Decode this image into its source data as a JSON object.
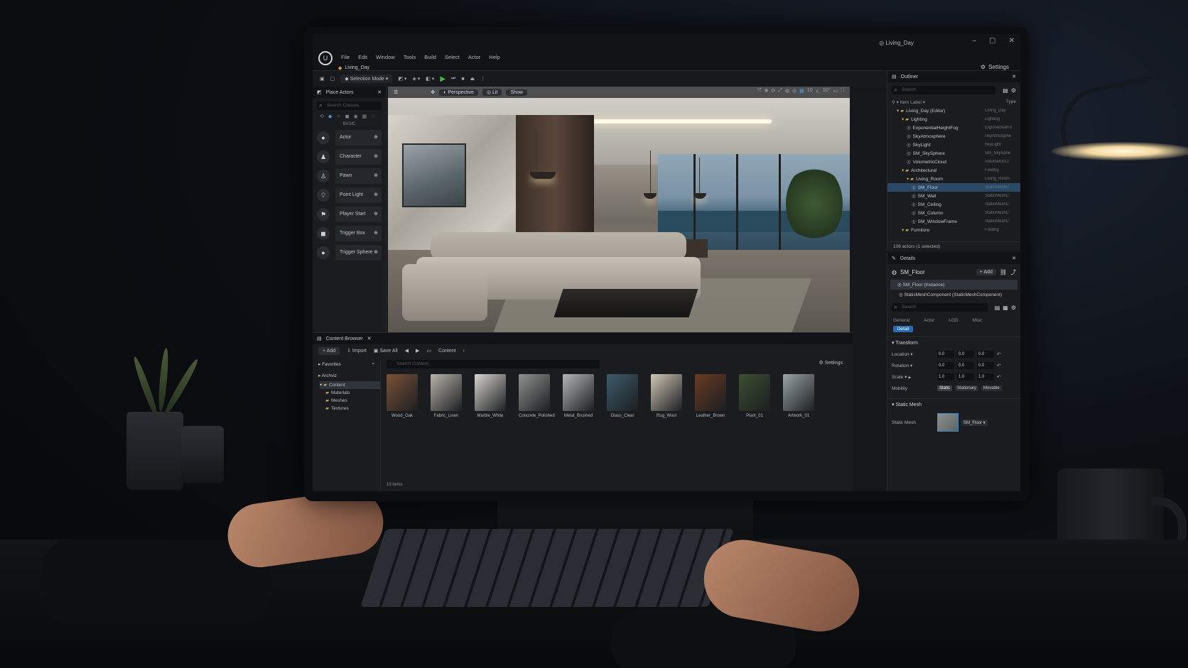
{
  "window": {
    "title": "Living_Day",
    "doc_tab": "Living_Day",
    "settings": "Settings"
  },
  "menu": [
    "File",
    "Edit",
    "Window",
    "Tools",
    "Build",
    "Select",
    "Actor",
    "Help"
  ],
  "toolbar": {
    "mode": "Selection Mode"
  },
  "viewport": {
    "perspective": "Perspective",
    "lit": "Lit",
    "show": "Show",
    "snap_value": "10",
    "snap_angle": "10°"
  },
  "place_actors": {
    "tab": "Place Actors",
    "search_placeholder": "Search Classes",
    "category": "BASIC",
    "items": [
      {
        "label": "Actor",
        "icon": "sphere-icon"
      },
      {
        "label": "Character",
        "icon": "character-icon"
      },
      {
        "label": "Pawn",
        "icon": "pawn-icon"
      },
      {
        "label": "Point Light",
        "icon": "bulb-icon"
      },
      {
        "label": "Player Start",
        "icon": "flag-icon"
      },
      {
        "label": "Trigger Box",
        "icon": "box-icon"
      },
      {
        "label": "Trigger Sphere",
        "icon": "sphere-icon"
      }
    ]
  },
  "outliner": {
    "tab": "Outliner",
    "search_placeholder": "Search",
    "col_label": "Item Label",
    "col_type": "Type",
    "rows": [
      {
        "label": "Living_Day (Editor)",
        "type": "Living_Day",
        "indent": 1,
        "folder": true
      },
      {
        "label": "Lighting",
        "type": "Lighting",
        "indent": 2,
        "folder": true
      },
      {
        "label": "ExponentialHeightFog",
        "type": "ExponentialFo",
        "indent": 3
      },
      {
        "label": "SkyAtmosphere",
        "type": "SkyAtmosphe",
        "indent": 3
      },
      {
        "label": "SkyLight",
        "type": "SkyLight",
        "indent": 3
      },
      {
        "label": "SM_SkySphere",
        "type": "SM_SkySphe",
        "indent": 3
      },
      {
        "label": "VolumetricCloud",
        "type": "VolumetricCl",
        "indent": 3
      },
      {
        "label": "Architectural",
        "type": "Folding",
        "indent": 2,
        "folder": true
      },
      {
        "label": "Living_Room",
        "type": "Living_Room",
        "indent": 3,
        "folder": true
      },
      {
        "label": "SM_Floor",
        "type": "StaticMeshC",
        "indent": 4,
        "selected": true
      },
      {
        "label": "SM_Wall",
        "type": "StaticMeshC",
        "indent": 4
      },
      {
        "label": "SM_Ceiling",
        "type": "StaticMeshC",
        "indent": 4
      },
      {
        "label": "SM_Column",
        "type": "StaticMeshC",
        "indent": 4
      },
      {
        "label": "SM_WindowFrame",
        "type": "StaticMeshC",
        "indent": 4
      },
      {
        "label": "Furniture",
        "type": "Folding",
        "indent": 2,
        "folder": true
      }
    ],
    "footer": "108 actors (1 selected)"
  },
  "details": {
    "tab": "Details",
    "object": "SM_Floor",
    "add": "+ Add",
    "instance": "SM_Floor (Instance)",
    "component": "StaticMeshComponent (StaticMeshComponent)",
    "search_placeholder": "Search",
    "tabs": [
      "General",
      "Actor",
      "LOD",
      "Misc"
    ],
    "active_tab": "Detail",
    "transform_section": "Transform",
    "location": {
      "label": "Location",
      "values": [
        "0.0",
        "0.0",
        "0.0"
      ]
    },
    "rotation": {
      "label": "Rotation",
      "values": [
        "0.0",
        "0.0",
        "0.0"
      ]
    },
    "scale": {
      "label": "Scale",
      "values": [
        "1.0",
        "1.0",
        "1.0"
      ]
    },
    "mobility": {
      "label": "Mobility",
      "options": [
        "Static",
        "Stationary",
        "Movable"
      ]
    },
    "static_mesh_section": "Static Mesh",
    "static_mesh_label": "Static Mesh",
    "static_mesh_value": "SM_Floor"
  },
  "content_browser": {
    "tab": "Content Browser",
    "add": "+ Add",
    "import": "Import",
    "save_all": "Save All",
    "path": "Content",
    "favorites": "Favorites",
    "archviz": "Archviz",
    "folders": [
      "Content",
      "Materials",
      "Meshes",
      "Textures"
    ],
    "search_placeholder": "Search Content",
    "settings": "Settings",
    "assets": [
      {
        "name": "Wood_Oak",
        "color": "#7a5238"
      },
      {
        "name": "Fabric_Linen",
        "color": "#b9b4aa"
      },
      {
        "name": "Marble_White",
        "color": "#d7d4ce"
      },
      {
        "name": "Concrete_Polished",
        "color": "#8f918f"
      },
      {
        "name": "Metal_Brushed",
        "color": "#b3b6b9"
      },
      {
        "name": "Glass_Clear",
        "color": "#3e5b6b"
      },
      {
        "name": "Rug_Wool",
        "color": "#cfc6b6"
      },
      {
        "name": "Leather_Brown",
        "color": "#6a3b22"
      },
      {
        "name": "Plant_01",
        "color": "#3c4f32"
      },
      {
        "name": "Artwork_01",
        "color": "#9aa4a8"
      }
    ],
    "count": "10 items"
  }
}
